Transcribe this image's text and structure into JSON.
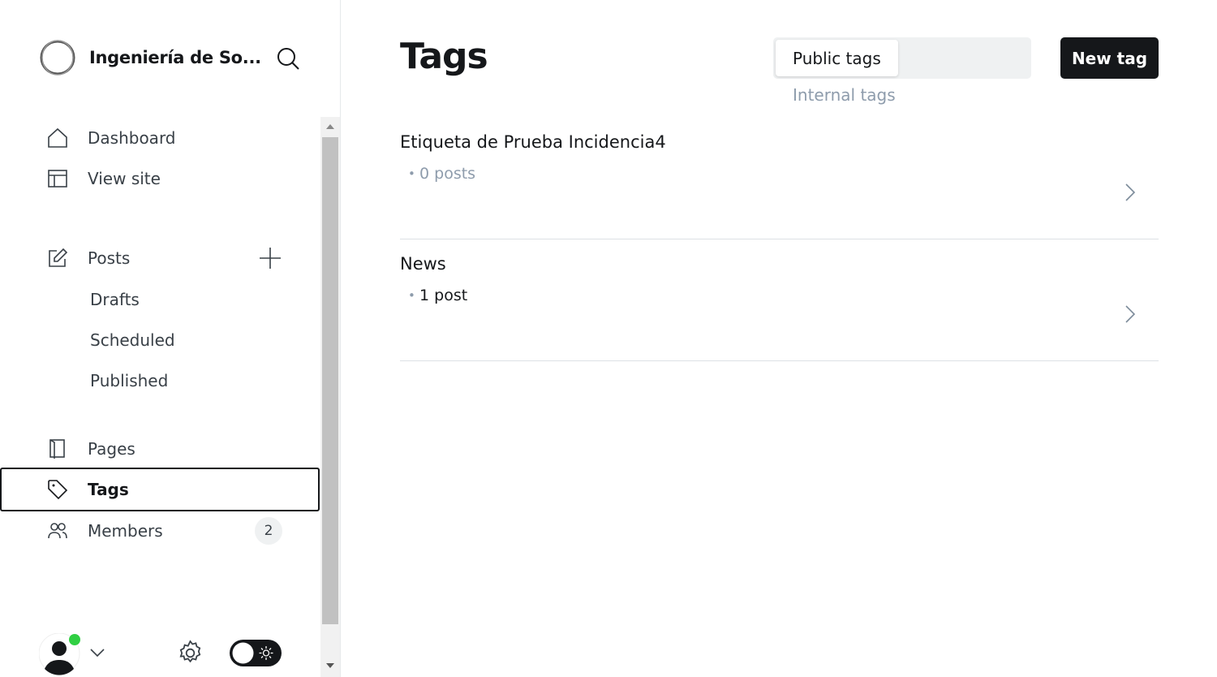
{
  "site": {
    "name": "Ingeniería de So..."
  },
  "nav": {
    "dashboard": "Dashboard",
    "view_site": "View site",
    "posts": "Posts",
    "drafts": "Drafts",
    "scheduled": "Scheduled",
    "published": "Published",
    "pages": "Pages",
    "tags": "Tags",
    "members": "Members",
    "members_count": "2"
  },
  "main": {
    "title": "Tags",
    "tab_public": "Public tags",
    "tab_internal": "Internal tags",
    "new_tag": "New tag",
    "tags": [
      {
        "name": "Etiqueta de Prueba Incidencia4",
        "count": "0 posts"
      },
      {
        "name": "News",
        "count": "1 post"
      }
    ]
  },
  "colors": {
    "accent": "#15171a",
    "muted": "#8e9cac",
    "online": "#30cf43"
  }
}
